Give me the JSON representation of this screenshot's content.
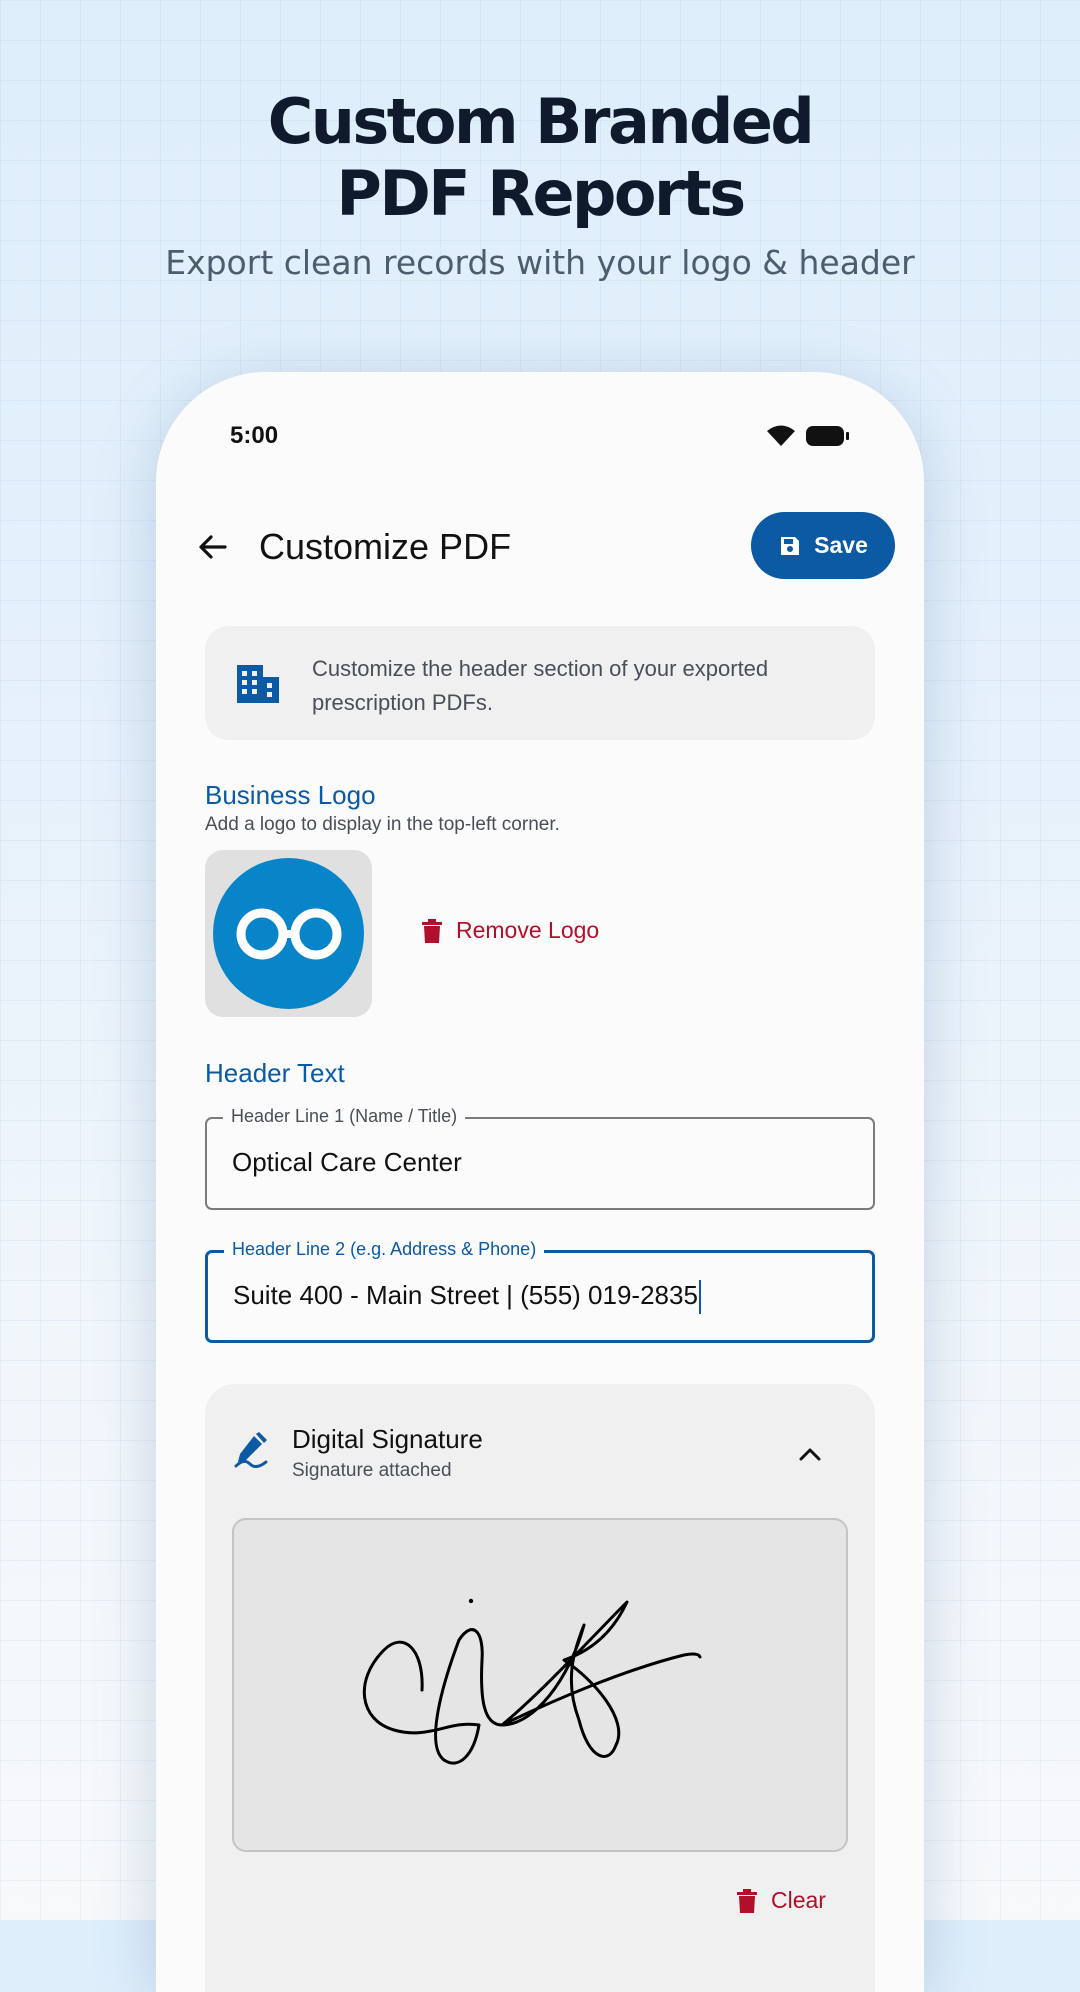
{
  "promo": {
    "title_line1": "Custom Branded",
    "title_line2": "PDF Reports",
    "subtitle": "Export clean records with your logo & header"
  },
  "status_bar": {
    "time": "5:00",
    "icons": [
      "wifi-icon",
      "battery-icon"
    ]
  },
  "app_bar": {
    "back_icon": "arrow-left-icon",
    "title": "Customize PDF",
    "save_label": "Save",
    "save_icon": "floppy-disk-icon"
  },
  "info_card": {
    "icon": "building-icon",
    "text": "Customize the header section of your exported prescription PDFs."
  },
  "business_logo": {
    "title": "Business Logo",
    "subtitle": "Add a logo to display in the top-left corner.",
    "logo_icon": "glasses-logo",
    "remove_label": "Remove Logo",
    "remove_icon": "trash-icon"
  },
  "header_text": {
    "title": "Header Text",
    "line1": {
      "label": "Header Line 1 (Name / Title)",
      "value": "Optical Care Center"
    },
    "line2": {
      "label": "Header Line 2 (e.g. Address & Phone)",
      "value": "Suite 400 - Main Street | (555) 019-2835"
    }
  },
  "signature": {
    "icon": "signature-pen-icon",
    "title": "Digital Signature",
    "status": "Signature attached",
    "collapse_icon": "chevron-up-icon",
    "clear_label": "Clear",
    "clear_icon": "trash-icon"
  },
  "colors": {
    "primary": "#0b5aa3",
    "danger": "#b0102a",
    "logo_blue": "#0884c8",
    "heading": "#0f1b2d"
  }
}
